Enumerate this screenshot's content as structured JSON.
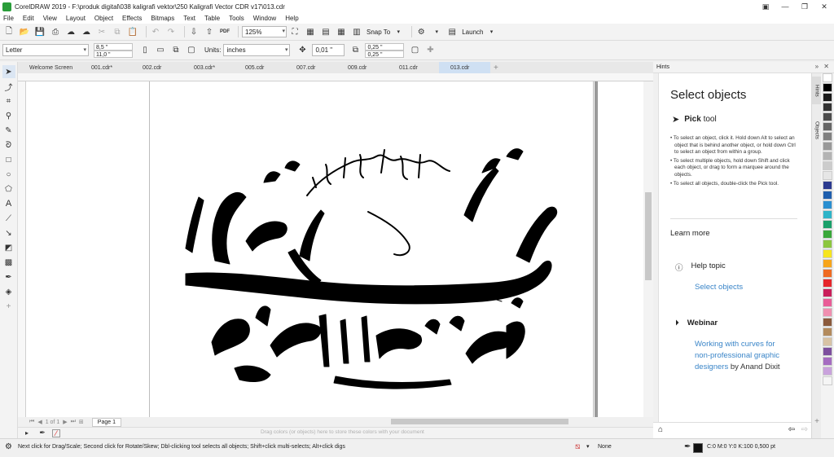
{
  "window": {
    "title": "CorelDRAW 2019 - F:\\produk digital\\038 kaligrafi vektor\\250 Kaligrafi Vector CDR v17\\013.cdr"
  },
  "menu": [
    "File",
    "Edit",
    "View",
    "Layout",
    "Object",
    "Effects",
    "Bitmaps",
    "Text",
    "Table",
    "Tools",
    "Window",
    "Help"
  ],
  "toolbar": {
    "zoom": "125%",
    "pdf_label": "PDF",
    "snap_to": "Snap To",
    "launch": "Launch"
  },
  "property_bar": {
    "page_size": "Letter",
    "width": "8,5 \"",
    "height": "11,0 \"",
    "units_label": "Units:",
    "units": "inches",
    "nudge": "0,01 \"",
    "dup_x": "0,25 \"",
    "dup_y": "0,25 \""
  },
  "doc_tabs": [
    "Welcome Screen",
    "001.cdr*",
    "002.cdr",
    "003.cdr*",
    "005.cdr",
    "007.cdr",
    "009.cdr",
    "011.cdr",
    "013.cdr"
  ],
  "active_tab": "013.cdr",
  "page_nav": {
    "page_count": "1 of 1",
    "page_tab": "Page 1"
  },
  "color_strip_hint": "Drag colors (or objects) here to store these colors with your document",
  "hints": {
    "panel_title": "Hints",
    "heading": "Select objects",
    "tool_bold": "Pick",
    "tool_rest": " tool",
    "bullets": [
      "To select an object, click it. Hold down Alt to select an object that is behind another object, or hold down Ctrl to select an object from within a group.",
      "To select multiple objects, hold down Shift and click each object, or drag to form a marquee around the objects.",
      "To select all objects, double-click the Pick tool."
    ],
    "learn_more": "Learn more",
    "help_topic": "Help topic",
    "help_link": "Select objects",
    "webinar": "Webinar",
    "webinar_link_1": "Working with curves for",
    "webinar_link_2": "non-professional graphic",
    "webinar_link_3": "designers",
    "webinar_by": " by Anand Dixit"
  },
  "docker_tabs": [
    "Hints",
    "Objects"
  ],
  "status": {
    "message": "Next click for Drag/Scale; Second click for Rotate/Skew; Dbl-clicking tool selects all objects; Shift+click multi-selects; Alt+click digs",
    "fill": "None",
    "outline": "C:0 M:0 Y:0 K:100  0,500 pt"
  },
  "palette_colors": [
    "#ffffff",
    "#000000",
    "#1a1a1a",
    "#333333",
    "#4d4d4d",
    "#666666",
    "#808080",
    "#999999",
    "#b3b3b3",
    "#cccccc",
    "#e6e6e6",
    "#2b3a8f",
    "#1f5fae",
    "#2a8fd1",
    "#2eb4c8",
    "#1aa06a",
    "#3aa83a",
    "#8cc63f",
    "#f6e51f",
    "#f7a51b",
    "#ef6b22",
    "#e6262b",
    "#c91e5a",
    "#e95d97",
    "#f08fb0",
    "#8b5a3c",
    "#b38b5d",
    "#d8c3a5",
    "#7d4f9e",
    "#a56cc1",
    "#c9a2dc",
    "#f5f5f5"
  ]
}
